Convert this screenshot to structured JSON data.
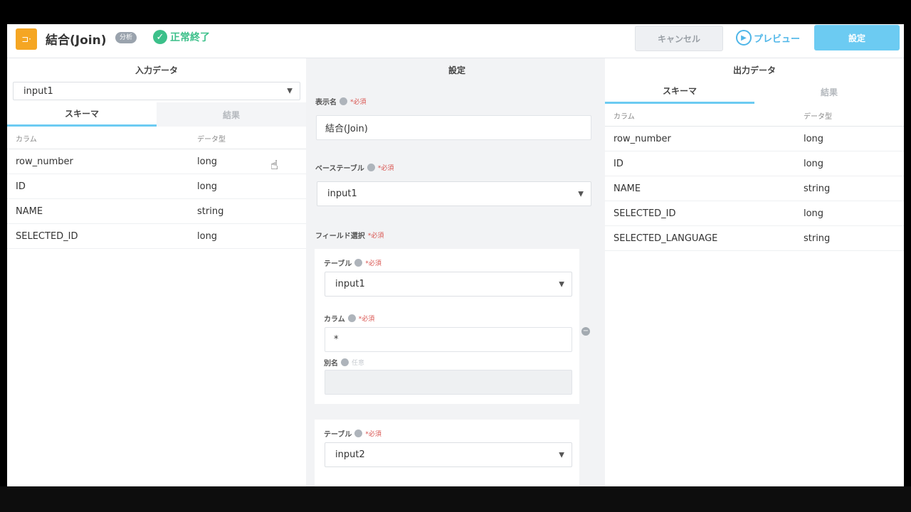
{
  "header": {
    "title": "結合(Join)",
    "badge": "分析",
    "status": "正常終了",
    "cancel_label": "キャンセル",
    "preview_label": "プレビュー",
    "set_label": "設定"
  },
  "left": {
    "title": "入力データ",
    "selected_input": "input1",
    "tabs": [
      "スキーマ",
      "結果"
    ],
    "columns": [
      "カラム",
      "データ型"
    ],
    "rows": [
      [
        "row_number",
        "long"
      ],
      [
        "ID",
        "long"
      ],
      [
        "NAME",
        "string"
      ],
      [
        "SELECTED_ID",
        "long"
      ]
    ]
  },
  "middle": {
    "title": "設定",
    "display_name_label": "表示名",
    "display_name_value": "結合(Join)",
    "required": "*必須",
    "optional": "任意",
    "base_table_label": "ベーステーブル",
    "base_table_value": "input1",
    "field_select_label": "フィールド選択",
    "table_label": "テーブル",
    "column_label": "カラム",
    "alias_label": "別名",
    "field1": {
      "table": "input1",
      "column": "*",
      "alias": ""
    },
    "field2": {
      "table": "input2"
    }
  },
  "right": {
    "title": "出力データ",
    "tabs": [
      "スキーマ",
      "結果"
    ],
    "columns": [
      "カラム",
      "データ型"
    ],
    "rows": [
      [
        "row_number",
        "long"
      ],
      [
        "ID",
        "long"
      ],
      [
        "NAME",
        "string"
      ],
      [
        "SELECTED_ID",
        "long"
      ],
      [
        "SELECTED_LANGUAGE",
        "string"
      ]
    ]
  }
}
